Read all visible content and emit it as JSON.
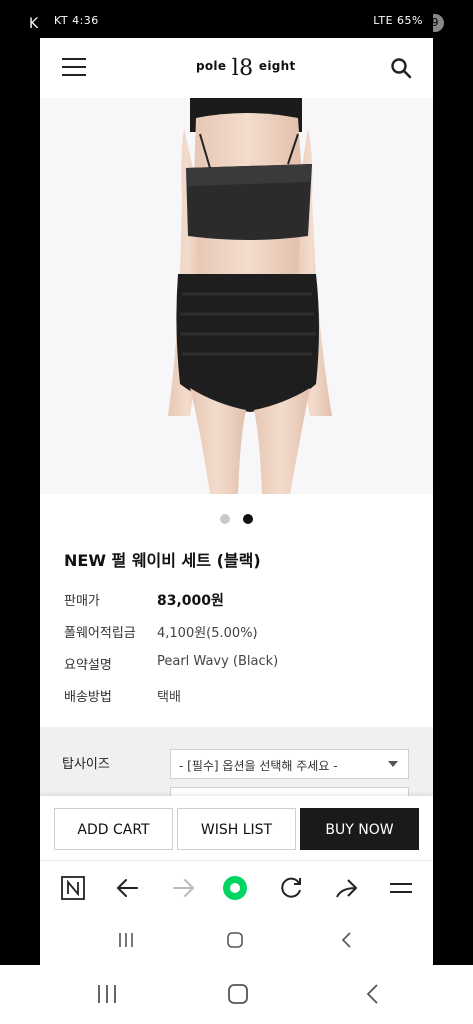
{
  "status_bar": {
    "left_text": "KT 4:36",
    "right_text": "LTE 65%"
  },
  "edge_left_text": "K",
  "header": {
    "logo_left": "pole",
    "logo_mark": "l8",
    "logo_right": "eight"
  },
  "product": {
    "image_icon": "swimsuit-product-photo",
    "carousel_dots": 2,
    "active_dot": 2,
    "title": "NEW 펄 웨이비 세트 (블랙)",
    "info": [
      {
        "label": "판매가",
        "value": "83,000원"
      },
      {
        "label": "폴웨어적립금",
        "value": "4,100원(5.00%)"
      },
      {
        "label": "요약설명",
        "value": "Pearl Wavy (Black)"
      },
      {
        "label": "배송방법",
        "value": "택배"
      }
    ]
  },
  "options": {
    "top_size_label": "탑사이즈",
    "top_size_placeholder": "- [필수] 옵션을 선택해 주세요 -"
  },
  "actions": {
    "add_cart": "ADD CART",
    "wish_list": "WISH LIST",
    "buy_now": "BUY NOW"
  },
  "browser_toolbar": {
    "icons": [
      "naver-icon",
      "back-arrow-icon",
      "forward-arrow-icon",
      "green-dot-icon",
      "refresh-icon",
      "share-icon",
      "menu-icon"
    ],
    "accent_color": "#00d564"
  },
  "nav_icons": [
    "recent-apps-icon",
    "home-icon",
    "back-icon"
  ]
}
